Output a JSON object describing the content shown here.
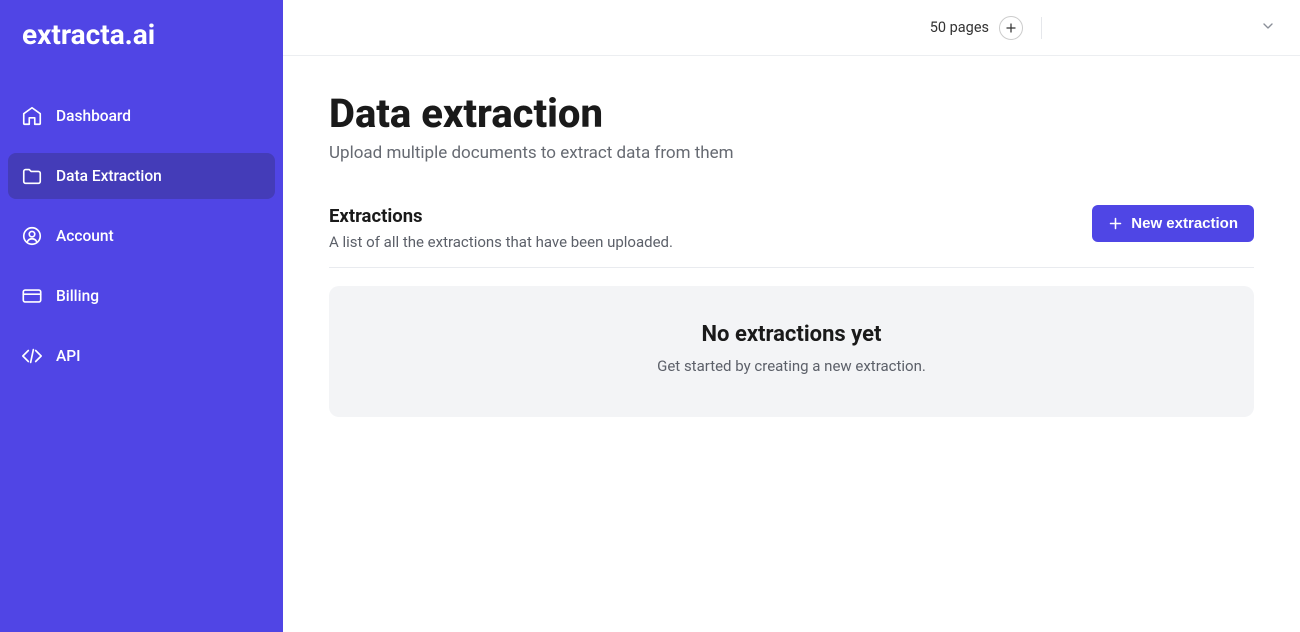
{
  "brand": "extracta.ai",
  "sidebar": {
    "items": [
      {
        "label": "Dashboard"
      },
      {
        "label": "Data Extraction"
      },
      {
        "label": "Account"
      },
      {
        "label": "Billing"
      },
      {
        "label": "API"
      }
    ]
  },
  "topbar": {
    "pages_label": "50 pages"
  },
  "page": {
    "title": "Data extraction",
    "subtitle": "Upload multiple documents to extract data from them"
  },
  "section": {
    "title": "Extractions",
    "subtitle": "A list of all the extractions that have been uploaded.",
    "new_button": "New extraction"
  },
  "empty": {
    "title": "No extractions yet",
    "subtitle": "Get started by creating a new extraction."
  }
}
